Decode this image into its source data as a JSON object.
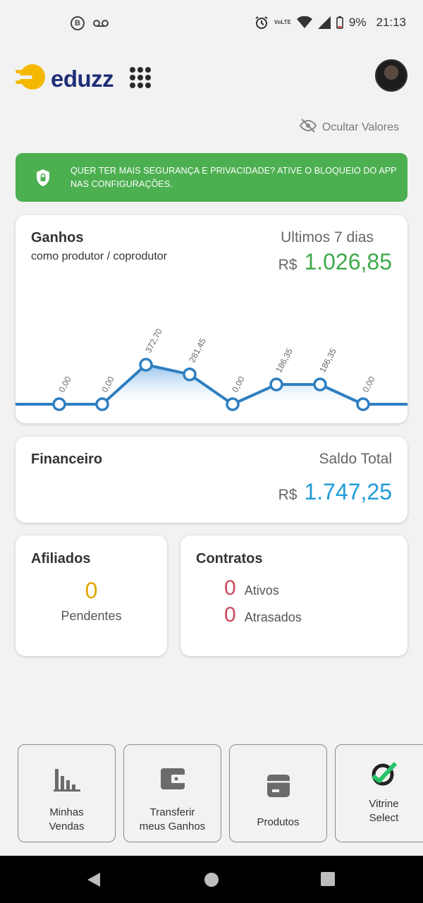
{
  "status_bar": {
    "badge_letter": "B",
    "volte_top": "Vo",
    "volte_bottom": "LTE",
    "battery": "9%",
    "time": "21:13"
  },
  "header": {
    "logo_text": "eduzz"
  },
  "hide_values": {
    "label": "Ocultar Valores"
  },
  "banner": {
    "line1": "QUER TER MAIS SEGURANÇA E PRIVACIDADE? ATIVE O BLOQUEIO DO APP",
    "line2": "NAS CONFIGURAÇÕES.",
    "color": "#4caf50"
  },
  "earnings": {
    "title": "Ganhos",
    "subtitle": "como produtor / coprodutor",
    "period": "Ultimos 7 dias",
    "currency": "R$",
    "total": "1.026,85"
  },
  "chart_data": {
    "type": "area",
    "values": [
      0,
      0,
      372.7,
      281.45,
      0,
      186.35,
      186.35,
      0
    ],
    "labels": [
      "0,00",
      "0,00",
      "372,70",
      "281,45",
      "0,00",
      "186,35",
      "186,35",
      "0,00"
    ],
    "line_color": "#2f7fc1",
    "grid": false
  },
  "financial": {
    "title": "Financeiro",
    "saldo_label": "Saldo Total",
    "currency": "R$",
    "total": "1.747,25"
  },
  "affiliates": {
    "title": "Afiliados",
    "count": "0",
    "label": "Pendentes"
  },
  "contracts": {
    "title": "Contratos",
    "active_count": "0",
    "active_label": "Ativos",
    "late_count": "0",
    "late_label": "Atrasados"
  },
  "shortcuts": {
    "sales_line1": "Minhas",
    "sales_line2": "Vendas",
    "transfer_line1": "Transferir",
    "transfer_line2": "meus Ganhos",
    "products": "Produtos",
    "vitrine_line1": "Vitrine",
    "vitrine_line2": "Select"
  },
  "icons": {
    "accent_green": "#3faa4b",
    "accent_blue": "#1e9bd7",
    "accent_yellow": "#e0a800",
    "accent_red": "#c94a5a"
  }
}
